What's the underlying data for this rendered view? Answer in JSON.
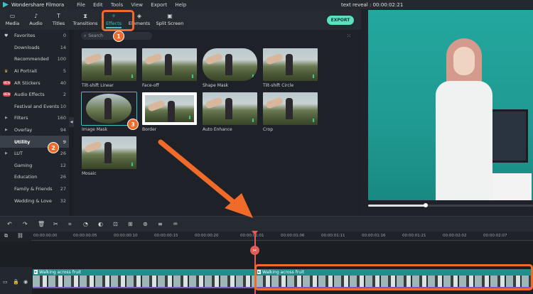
{
  "app": {
    "name": "Wondershare Filmora",
    "window_title": "text reveal : 00:00:02:21"
  },
  "menu": [
    "File",
    "Edit",
    "Tools",
    "View",
    "Export",
    "Help"
  ],
  "tabs": [
    {
      "label": "Media",
      "icon": "folder-icon"
    },
    {
      "label": "Audio",
      "icon": "music-note-icon"
    },
    {
      "label": "Titles",
      "icon": "text-icon"
    },
    {
      "label": "Transitions",
      "icon": "transitions-icon"
    },
    {
      "label": "Effects",
      "icon": "effects-icon",
      "active": true
    },
    {
      "label": "Elements",
      "icon": "elements-icon"
    },
    {
      "label": "Split Screen",
      "icon": "split-screen-icon"
    }
  ],
  "export_label": "EXPORT",
  "sidebar": {
    "items": [
      {
        "label": "Favorites",
        "count": "0",
        "icon": "heart-icon"
      },
      {
        "label": "Downloads",
        "count": "14"
      },
      {
        "label": "Recommended",
        "count": "100"
      },
      {
        "label": "AI Portrait",
        "count": "5",
        "icon": "ai-icon"
      },
      {
        "label": "AR Stickers",
        "count": "40",
        "badge": "NEW"
      },
      {
        "label": "Audio Effects",
        "count": "2",
        "badge": "NEW"
      },
      {
        "label": "Festival and Events",
        "count": "10"
      },
      {
        "label": "Filters",
        "count": "160",
        "expandable": true
      },
      {
        "label": "Overlay",
        "count": "94",
        "expandable": true
      },
      {
        "label": "Utility",
        "count": "9",
        "selected": true
      },
      {
        "label": "LUT",
        "count": "26",
        "expandable": true
      },
      {
        "label": "Gaming",
        "count": "12"
      },
      {
        "label": "Education",
        "count": "26"
      },
      {
        "label": "Family & Friends",
        "count": "27"
      },
      {
        "label": "Wedding & Love",
        "count": "32"
      }
    ]
  },
  "search": {
    "placeholder": "Search"
  },
  "effects": [
    {
      "label": "Tilt-shift Linear"
    },
    {
      "label": "Face-off"
    },
    {
      "label": "Shape Mask"
    },
    {
      "label": "Tilt-shift Circle"
    },
    {
      "label": "Image Mask",
      "selected": true
    },
    {
      "label": "Border"
    },
    {
      "label": "Auto Enhance"
    },
    {
      "label": "Crop"
    },
    {
      "label": "Mosaic"
    }
  ],
  "timeline": {
    "ruler": [
      "00:00:00:00",
      "00:00:00:05",
      "00:00:00:10",
      "00:00:00:15",
      "00:00:00:20",
      "00:00:01:01",
      "00:00:01:06",
      "00:00:01:11",
      "00:00:01:16",
      "00:00:01:21",
      "00:00:02:02",
      "00:00:02:07"
    ],
    "clip_title": "Walking across fruit",
    "clip_title_2": "Walking across fruit",
    "progress": 0.35
  },
  "annotations": [
    "1",
    "2",
    "3"
  ],
  "colors": {
    "accent": "#3fc1c9",
    "annotation": "#f06b2a",
    "export": "#5de0c0",
    "playhead": "#e45a55"
  }
}
